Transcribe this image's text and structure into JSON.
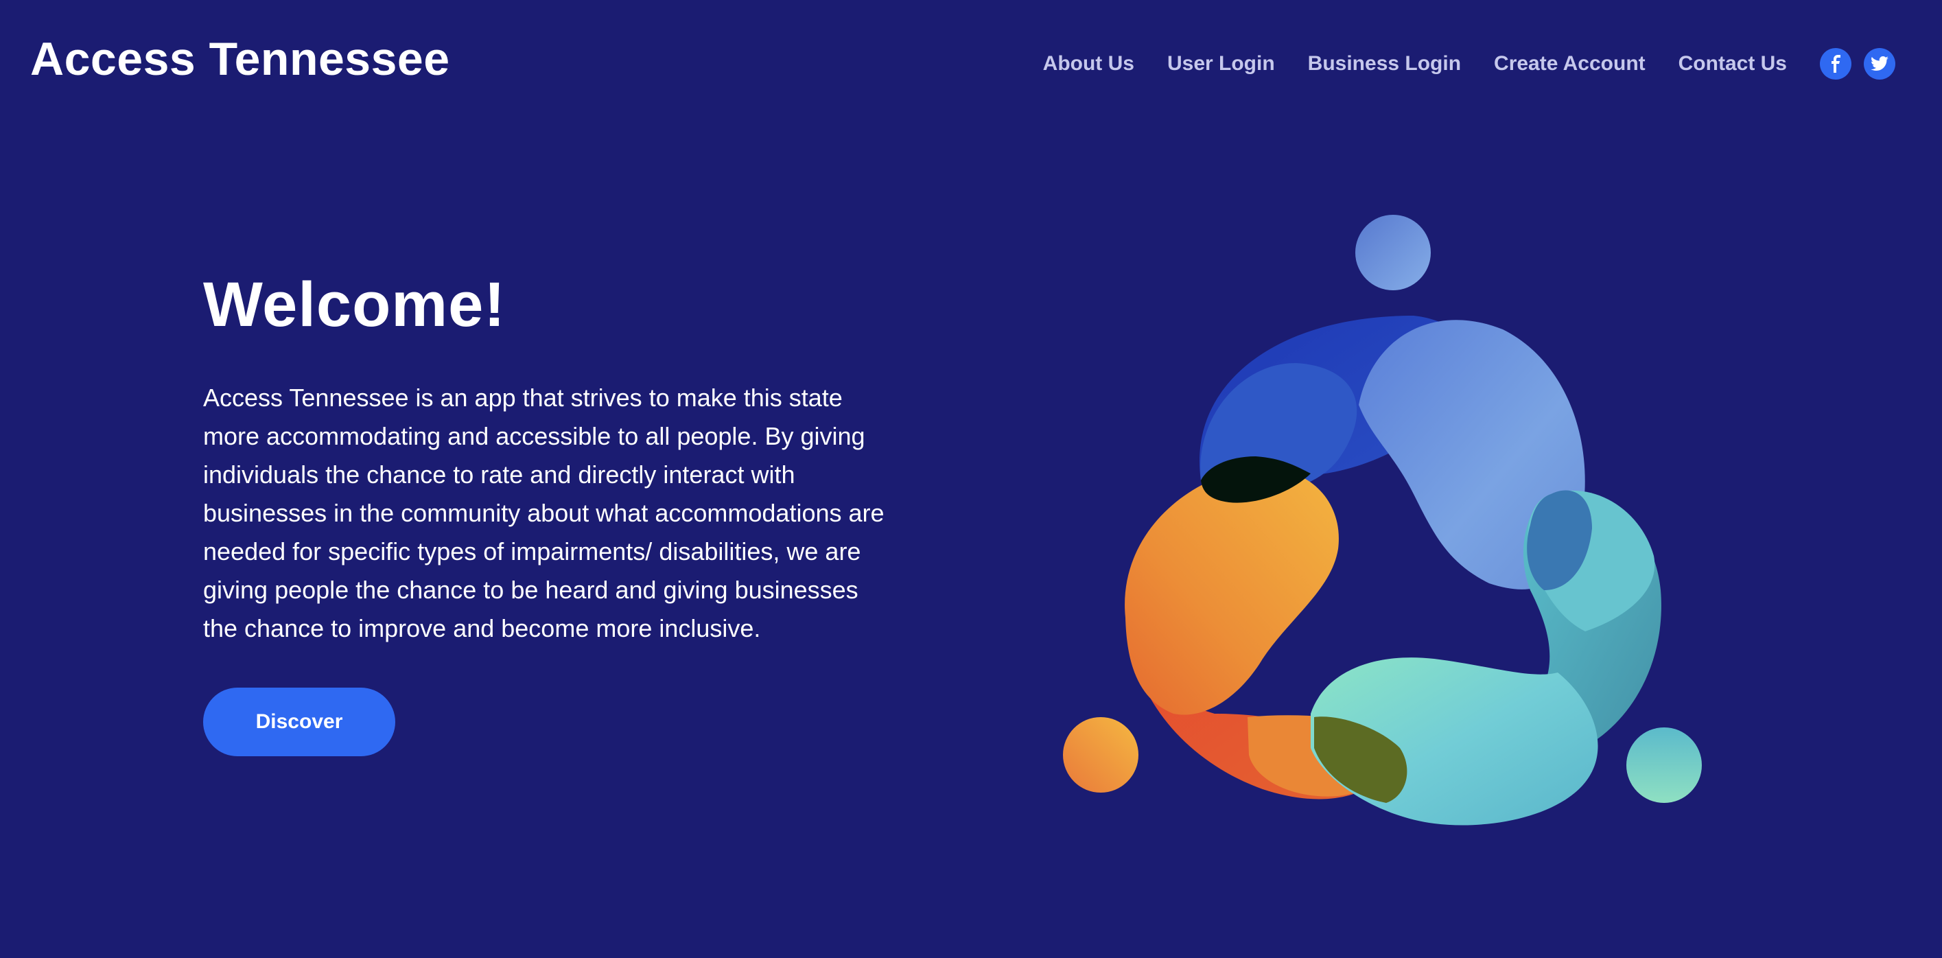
{
  "header": {
    "site_title": "Access Tennessee",
    "nav": [
      {
        "label": "About Us"
      },
      {
        "label": "User Login"
      },
      {
        "label": "Business Login"
      },
      {
        "label": "Create Account"
      },
      {
        "label": "Contact Us"
      }
    ],
    "social": [
      {
        "icon": "facebook-icon"
      },
      {
        "icon": "twitter-icon"
      }
    ]
  },
  "hero": {
    "heading": "Welcome!",
    "description": "Access Tennessee is an app that strives to make this state more accommodating and accessible to all people. By giving individuals the chance to rate and directly interact with businesses in the community about what accommodations are needed for specific types of impairments/ disabilities, we are giving people the chance to be heard and giving businesses the chance to improve and become more inclusive.",
    "cta_label": "Discover"
  },
  "colors": {
    "background": "#1b1c72",
    "accent": "#2f69f2",
    "nav_text": "#c6c8ec"
  }
}
